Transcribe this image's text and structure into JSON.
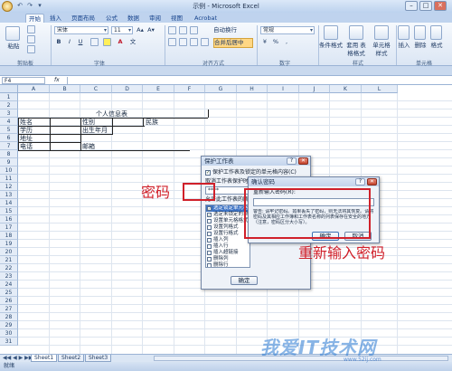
{
  "window": {
    "title": "示例 - Microsoft Excel",
    "min": "–",
    "max": "□",
    "close": "✕"
  },
  "quick_access": [
    "↶",
    "↷",
    "▾"
  ],
  "tabs": [
    "开始",
    "插入",
    "页面布局",
    "公式",
    "数据",
    "审阅",
    "视图",
    "Acrobat"
  ],
  "ribbon": {
    "clipboard": {
      "paste": "粘贴",
      "label": "剪贴板"
    },
    "font": {
      "name": "宋体",
      "size": "11",
      "bold": "B",
      "italic": "I",
      "underline": "U",
      "grow": "A▴",
      "shrink": "A▾",
      "label": "字体",
      "fontcolor": "A",
      "phonetic": "文"
    },
    "alignment": {
      "wrap": "自动换行",
      "merge": "合并后居中",
      "label": "对齐方式"
    },
    "number": {
      "format": "常规",
      "percent": "%",
      "comma": ",",
      "label": "数字"
    },
    "styles": {
      "conditional": "条件格式",
      "table": "套用 表格格式",
      "cell": "单元格 样式",
      "label": "样式"
    },
    "cells": {
      "insert": "插入",
      "delete": "删除",
      "format": "格式",
      "label": "单元格"
    }
  },
  "formula_bar": {
    "name_box": "F4",
    "fx": "fx"
  },
  "columns": [
    "A",
    "B",
    "C",
    "D",
    "E",
    "F",
    "G",
    "H",
    "I",
    "J",
    "K",
    "L"
  ],
  "rows": [
    "1",
    "2",
    "3",
    "4",
    "5",
    "6",
    "7",
    "8",
    "9",
    "10",
    "11",
    "12",
    "13",
    "14",
    "15",
    "16",
    "17",
    "18",
    "19",
    "20",
    "21",
    "22",
    "23",
    "24",
    "25",
    "26",
    "27",
    "28",
    "29",
    "30",
    "31"
  ],
  "cells": {
    "title": "个人信息表",
    "name": "姓名",
    "gender": "性别",
    "ethnicity": "民族",
    "education": "学历",
    "birth": "出生年月",
    "address": "地址",
    "phone": "电话",
    "postcode": "邮箱"
  },
  "sheets": [
    "Sheet1",
    "Sheet2",
    "Sheet3"
  ],
  "status": "就绪",
  "protect_dialog": {
    "title": "保护工作表",
    "protect_check": "保护工作表及锁定的单元格内容(C)",
    "pwd_label": "取消工作表保护时",
    "pwd_value": "****",
    "allow_label": "允许此工作表的所有",
    "options": [
      "选定锁定单元格",
      "选定未锁定的单元格",
      "设置单元格格式",
      "设置列格式",
      "设置行格式",
      "插入列",
      "插入行",
      "插入超链接",
      "删除列",
      "删除行"
    ],
    "ok": "确定",
    "cancel": "取消"
  },
  "confirm_dialog": {
    "title": "确认密码",
    "reenter": "重新输入密码(R):",
    "warning": "警告: 请牢记密码。如果丢失了密码，则无法将其恢复。请将密码及其相应工作簿和工作表名称的列表保存在安全的地方（注意，密码区分大小写）。",
    "ok": "确定",
    "cancel": "取消"
  },
  "annotations": {
    "password": "密码",
    "reenter": "重新输入密码"
  },
  "watermark": {
    "text": "我爱IT技术网",
    "url": "www.52ij.com"
  }
}
